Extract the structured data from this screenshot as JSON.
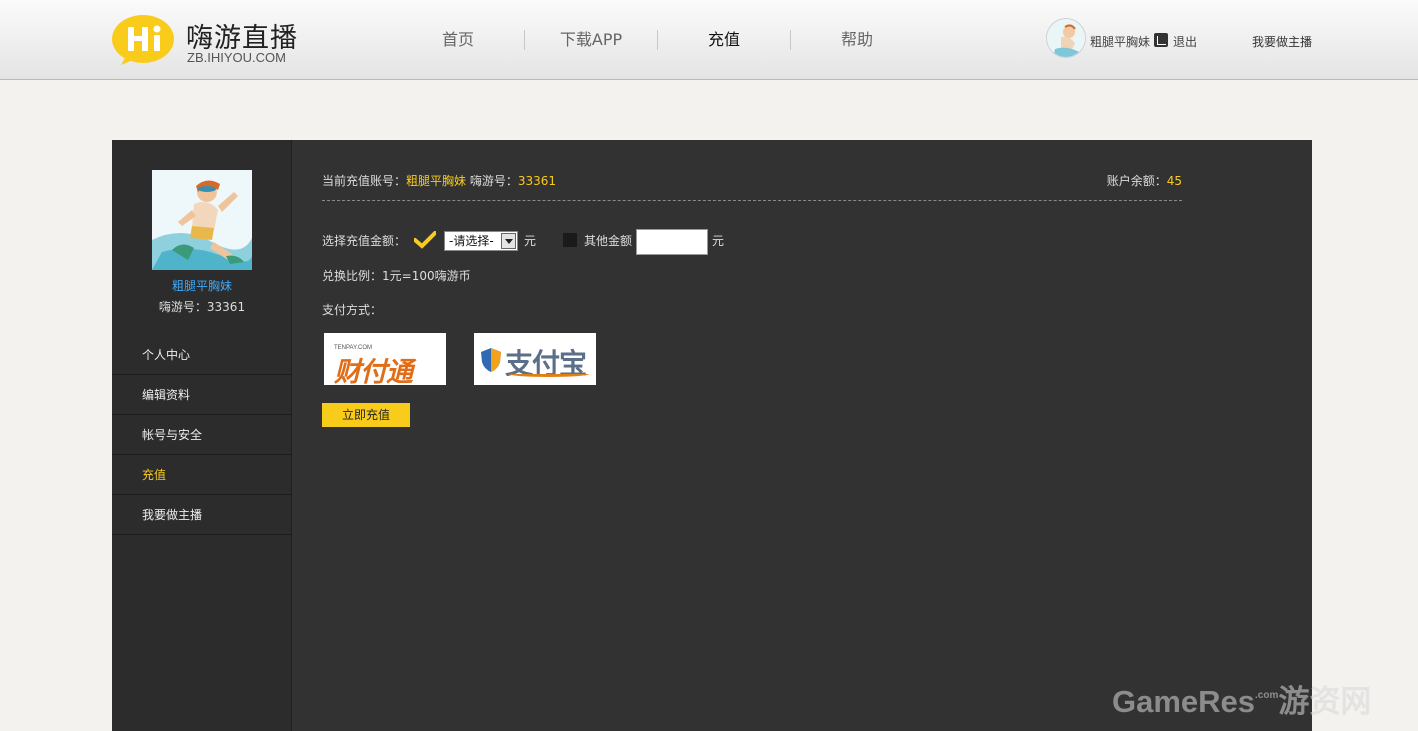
{
  "header": {
    "logo_title": "嗨游直播",
    "logo_url": "ZB.IHIYOU.COM",
    "nav": [
      {
        "label": "首页",
        "active": false
      },
      {
        "label": "下载APP",
        "active": false
      },
      {
        "label": "充值",
        "active": true
      },
      {
        "label": "帮助",
        "active": false
      }
    ],
    "username": "粗腿平胸妹",
    "logout": "退出",
    "become_anchor": "我要做主播"
  },
  "sidebar": {
    "username": "粗腿平胸妹",
    "id_label": "嗨游号：33361",
    "menu": [
      {
        "label": "个人中心",
        "active": false
      },
      {
        "label": "编辑资料",
        "active": false
      },
      {
        "label": "帐号与安全",
        "active": false
      },
      {
        "label": "充值",
        "active": true
      },
      {
        "label": "我要做主播",
        "active": false
      }
    ]
  },
  "recharge": {
    "account_label": "当前充值账号：",
    "account_name": "粗腿平胸妹",
    "id_label": "嗨游号：",
    "id_value": "33361",
    "balance_label": "账户余额：",
    "balance_value": "45",
    "amount_label": "选择充值金额：",
    "select_value": "-请选择-",
    "unit": "元",
    "other_label": "其他金额",
    "other_value": "",
    "ratio": "兑换比例：1元=100嗨游币",
    "pay_label": "支付方式：",
    "tenpay_small": "TENPAY.COM",
    "tenpay_text": "财付通",
    "alipay_text": "支付宝",
    "submit": "立即充值"
  },
  "watermark": {
    "main": "GameRes",
    "com": ".com",
    "cn": "游资网"
  },
  "colors": {
    "accent": "#f9cc1c",
    "panel": "#323232",
    "link": "#3fa9f5"
  }
}
